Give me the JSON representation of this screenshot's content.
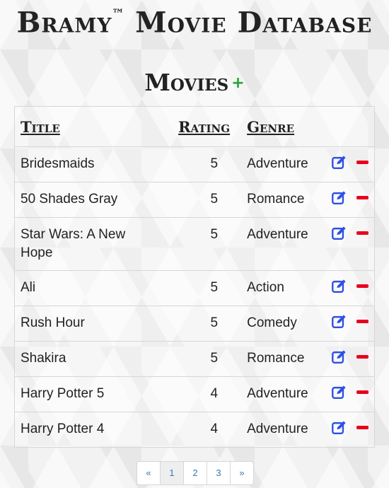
{
  "header": {
    "site_name": "Bramy",
    "trademark": "™",
    "site_suffix": "Movie Database"
  },
  "section": {
    "title": "Movies",
    "add_icon": "plus-icon",
    "add_glyph": "+"
  },
  "table": {
    "columns": [
      "Title",
      "Rating",
      "Genre"
    ],
    "rows": [
      {
        "title": "Bridesmaids",
        "rating": "5",
        "genre": "Adventure"
      },
      {
        "title": "50 Shades Gray",
        "rating": "5",
        "genre": "Romance"
      },
      {
        "title": "Star Wars: A New Hope",
        "rating": "5",
        "genre": "Adventure"
      },
      {
        "title": "Ali",
        "rating": "5",
        "genre": "Action"
      },
      {
        "title": "Rush Hour",
        "rating": "5",
        "genre": "Comedy"
      },
      {
        "title": "Shakira",
        "rating": "5",
        "genre": "Romance"
      },
      {
        "title": "Harry Potter 5",
        "rating": "4",
        "genre": "Adventure"
      },
      {
        "title": "Harry Potter 4",
        "rating": "4",
        "genre": "Adventure"
      }
    ],
    "row_actions": {
      "edit_icon": "edit-icon",
      "delete_icon": "minus-icon"
    }
  },
  "pagination": {
    "prev": "«",
    "pages": [
      "1",
      "2",
      "3"
    ],
    "current": "1",
    "next": "»"
  },
  "colors": {
    "add": "#28a33a",
    "edit": "#2f50e4",
    "delete": "#e8001c",
    "link": "#337ab7"
  }
}
